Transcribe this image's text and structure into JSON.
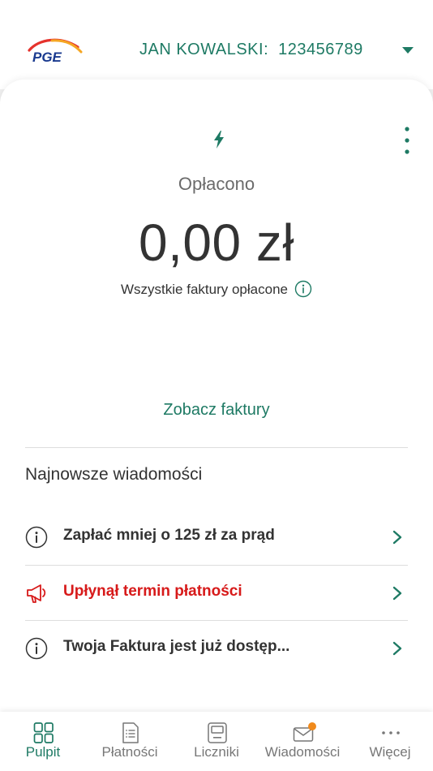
{
  "header": {
    "logo_text": "PGE",
    "account_name": "JAN KOWALSKI:",
    "account_number": "123456789"
  },
  "summary": {
    "status": "Opłacono",
    "amount": "0,00 zł",
    "note": "Wszystkie faktury opłacone",
    "see_invoices_link": "Zobacz faktury"
  },
  "messages": {
    "title": "Najnowsze wiadomości",
    "items": [
      {
        "text": "Zapłać mniej o 125 zł za prąd",
        "icon": "info-icon",
        "type": "info"
      },
      {
        "text": "Upłynął termin płatności",
        "icon": "megaphone-icon",
        "type": "alert"
      },
      {
        "text": "Twoja Faktura jest już dostęp...",
        "icon": "info-icon",
        "type": "info"
      }
    ]
  },
  "tabs": [
    {
      "label": "Pulpit",
      "icon": "dashboard-grid-icon",
      "active": true
    },
    {
      "label": "Płatności",
      "icon": "invoice-list-icon",
      "active": false
    },
    {
      "label": "Liczniki",
      "icon": "meter-icon",
      "active": false
    },
    {
      "label": "Wiadomości",
      "icon": "envelope-icon",
      "active": false,
      "badge": true
    },
    {
      "label": "Więcej",
      "icon": "more-dots-icon",
      "active": false
    }
  ],
  "colors": {
    "accent": "#1e7a64",
    "alert": "#d71a1a",
    "badge": "#f08a1c",
    "logo_blue": "#1a3a8f"
  }
}
